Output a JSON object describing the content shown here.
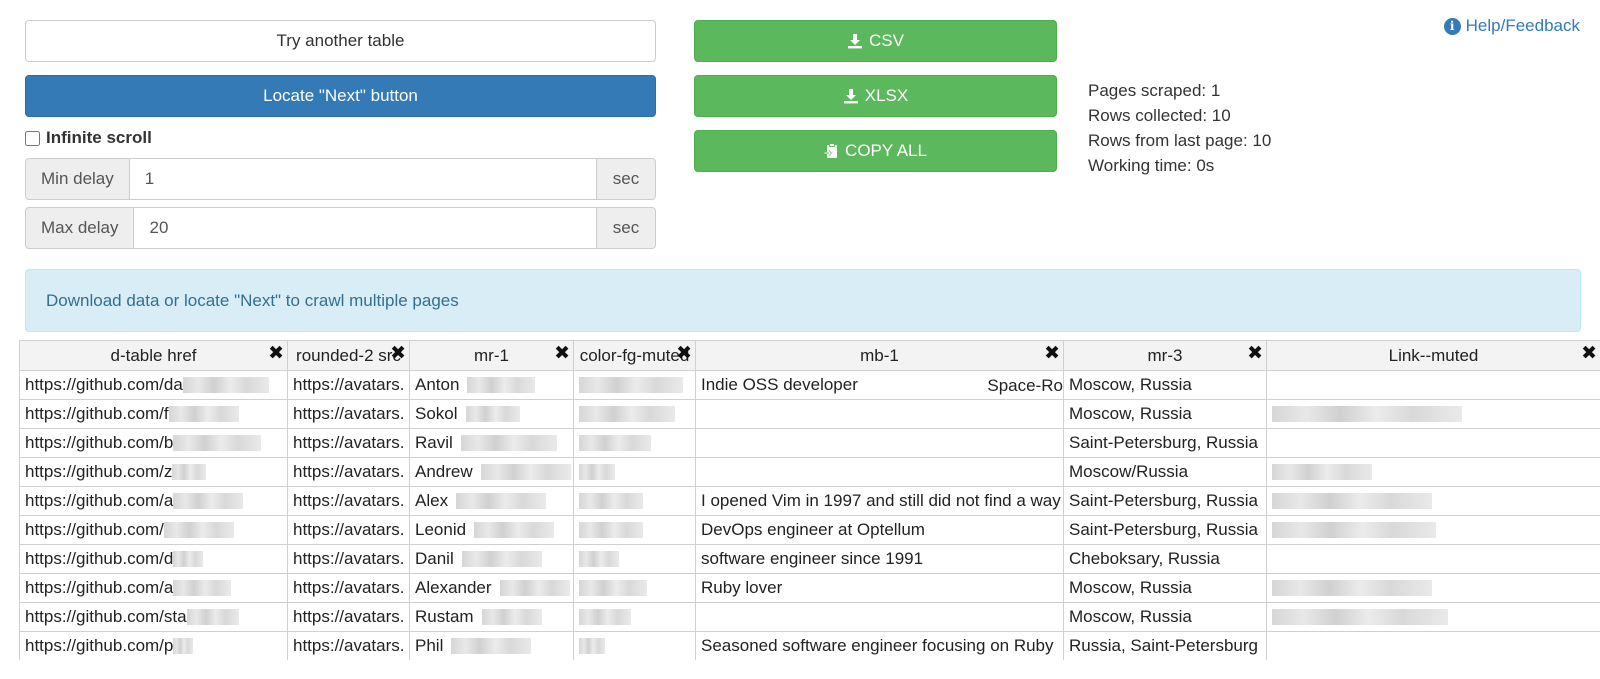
{
  "buttons": {
    "try_another": "Try another table",
    "locate_next": "Locate \"Next\" button",
    "csv": "CSV",
    "xlsx": "XLSX",
    "copy_all": "COPY ALL"
  },
  "infinite_scroll": {
    "label": "Infinite scroll",
    "checked": false
  },
  "delays": {
    "min": {
      "label": "Min delay",
      "value": "1",
      "unit": "sec"
    },
    "max": {
      "label": "Max delay",
      "value": "20",
      "unit": "sec"
    }
  },
  "stats": {
    "pages_scraped": "Pages scraped: 1",
    "rows_collected": "Rows collected: 10",
    "rows_last_page": "Rows from last page: 10",
    "working_time": "Working time: 0s"
  },
  "help": {
    "label": "Help/Feedback",
    "icon": "info-circle-icon"
  },
  "alert": "Download data or locate \"Next\" to crawl multiple pages",
  "remove_glyph": "✖",
  "table": {
    "columns": [
      "d-table href",
      "rounded-2 src",
      "mr-1",
      "color-fg-muted",
      "mb-1",
      "mr-3",
      "Link--muted"
    ],
    "rows": [
      {
        "href": "https://github.com/da",
        "src": "https://avatars.",
        "name": "Anton",
        "bio": "Indie OSS developer",
        "bio_extra": "Space-Ro",
        "loc": "Moscow, Russia"
      },
      {
        "href": "https://github.com/f",
        "src": "https://avatars.",
        "name": "Sokol",
        "bio": "",
        "bio_extra": "",
        "loc": "Moscow, Russia"
      },
      {
        "href": "https://github.com/b",
        "src": "https://avatars.",
        "name": "Ravil",
        "bio": "",
        "bio_extra": "",
        "loc": "Saint-Petersburg, Russia"
      },
      {
        "href": "https://github.com/z",
        "src": "https://avatars.",
        "name": "Andrew",
        "bio": "",
        "bio_extra": "",
        "loc": "Moscow/Russia"
      },
      {
        "href": "https://github.com/a",
        "src": "https://avatars.",
        "name": "Alex",
        "bio": "I opened Vim in 1997 and still did not find a way",
        "bio_extra": "",
        "loc": "Saint-Petersburg, Russia"
      },
      {
        "href": "https://github.com/",
        "src": "https://avatars.",
        "name": "Leonid",
        "bio": "DevOps engineer at Optellum",
        "bio_extra": "",
        "loc": "Saint-Petersburg, Russia"
      },
      {
        "href": "https://github.com/d",
        "src": "https://avatars.",
        "name": "Danil",
        "bio": "software engineer since 1991",
        "bio_extra": "",
        "loc": "Cheboksary, Russia"
      },
      {
        "href": "https://github.com/a",
        "src": "https://avatars.",
        "name": "Alexander",
        "bio": "Ruby lover",
        "bio_extra": "",
        "loc": "Moscow, Russia"
      },
      {
        "href": "https://github.com/sta",
        "src": "https://avatars.",
        "name": "Rustam",
        "bio": "",
        "bio_extra": "",
        "loc": "Moscow, Russia"
      },
      {
        "href": "https://github.com/p",
        "src": "https://avatars.",
        "name": "Phil",
        "bio": "Seasoned software engineer focusing on Ruby",
        "bio_extra": "",
        "loc": "Russia, Saint-Petersburg"
      }
    ]
  }
}
